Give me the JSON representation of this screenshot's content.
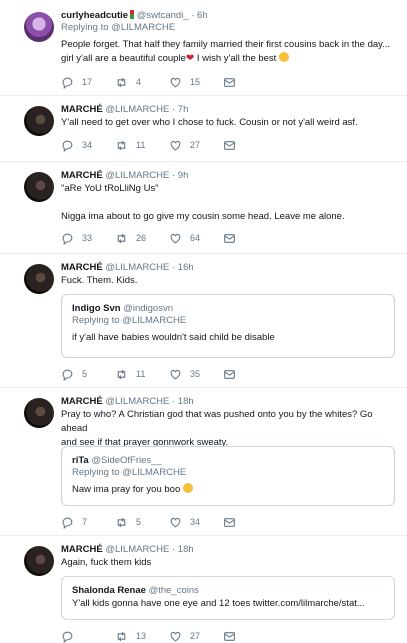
{
  "tweets": [
    {
      "name": "curlyheadcutie",
      "handle": "@swtcandi_",
      "time": "· 6h",
      "reply_label": "Replying to",
      "reply_to": "@LILMARCHE",
      "line1": "People forget. That half they family married their first cousins back in the day...",
      "line2a": "girl y'all are a beautiful couple",
      "line2b": " I wish y'all the best",
      "reply_count": "17",
      "retweet_count": "4",
      "like_count": "15"
    },
    {
      "name": "MARCHÉ",
      "handle": "@LILMARCHE · 7h",
      "text": "Y'all need to get over who I chose to fuck. Cousin or not y'all weird asf.",
      "reply_count": "34",
      "retweet_count": "11",
      "like_count": "27"
    },
    {
      "name": "MARCHÉ",
      "handle": "@LILMARCHE · 9h",
      "text1": "\"aRe YoU tRoLliNg Us\"",
      "text2": "Nigga ima about to go give my cousin some head. Leave me alone.",
      "reply_count": "33",
      "retweet_count": "26",
      "like_count": "64"
    },
    {
      "name": "MARCHÉ",
      "handle": "@LILMARCHE · 16h",
      "text": "Fuck. Them. Kids.",
      "quote": {
        "name": "Indigo Svn",
        "handle": "@indigosvn",
        "reply_label": "Replying to",
        "reply_to": "@LILMARCHE",
        "text": "if y'all have babies wouldn't said  child be disable"
      },
      "reply_count": "5",
      "retweet_count": "11",
      "like_count": "35"
    },
    {
      "name": "MARCHÉ",
      "handle": "@LILMARCHE · 18h",
      "text1": "Pray to who? A Christian god that was pushed onto you by the whites? Go ahead",
      "text2": "and see if that prayer gonnwork sweaty.",
      "quote": {
        "name": "riTa",
        "handle": "@SideOfFries__",
        "reply_label": "Replying to",
        "reply_to": "@LILMARCHE",
        "text": "Naw ima pray for you boo"
      },
      "reply_count": "7",
      "retweet_count": "5",
      "like_count": "34"
    },
    {
      "name": "MARCHÉ",
      "handle": "@LILMARCHE · 18h",
      "text": "Again, fuck them kids",
      "quote": {
        "name": "Shalonda Renae",
        "handle": "@the_coins",
        "text": "Y'all kids gonna have one eye and 12 toes twitter.com/lilmarche/stat..."
      },
      "reply_count": "",
      "retweet_count": "13",
      "like_count": "27"
    }
  ],
  "colors": {
    "text": "#14171a",
    "muted": "#657786",
    "border": "#e6ecf0",
    "quote_border": "#ccd6dd"
  },
  "icons": [
    "reply-icon",
    "retweet-icon",
    "like-icon",
    "message-icon",
    "verified-icon"
  ]
}
